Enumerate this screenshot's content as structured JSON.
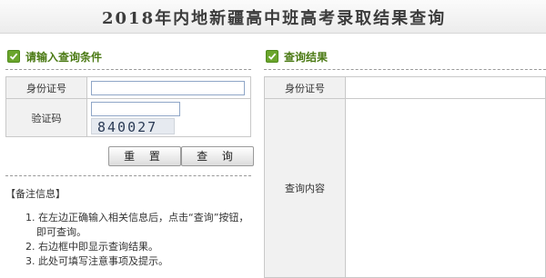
{
  "banner": {
    "title": "2018年内地新疆高中班高考录取结果查询"
  },
  "query_section": {
    "title": "请输入查询条件",
    "id_label": "身份证号",
    "id_value": "",
    "captcha_label": "验证码",
    "captcha_value": "",
    "captcha_code": "840027",
    "reset_button": "重 置",
    "query_button": "查 询"
  },
  "result_section": {
    "title": "查询结果",
    "id_label": "身份证号",
    "id_value": "",
    "content_label": "查询内容",
    "content_value": ""
  },
  "notes": {
    "title": "【备注信息】",
    "items": [
      "1. 在左边正确输入相关信息后，点击“查询”按钮，",
      "即可查询。",
      "2. 右边框中即显示查询结果。",
      "3. 此处可填写注意事项及提示。"
    ]
  },
  "colors": {
    "accent_green": "#4b7a14",
    "label_bg": "#f1f1f1",
    "border": "#c9c9c9"
  },
  "icons": {
    "section_icon": "check-icon"
  }
}
